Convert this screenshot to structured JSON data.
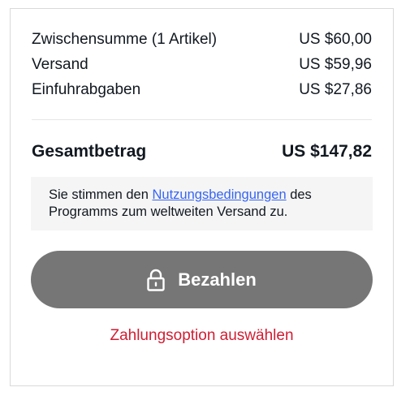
{
  "summary": {
    "lines": [
      {
        "label": "Zwischensumme (1 Artikel)",
        "value": "US $60,00"
      },
      {
        "label": "Versand",
        "value": "US $59,96"
      },
      {
        "label": "Einfuhrabgaben",
        "value": "US $27,86"
      }
    ],
    "total_label": "Gesamtbetrag",
    "total_value": "US $147,82"
  },
  "notice": {
    "text_before": "Sie stimmen den ",
    "link_text": "Nutzungsbedingungen",
    "text_after": " des Programms zum weltweiten Versand zu."
  },
  "pay_button": {
    "label": "Bezahlen",
    "icon": "lock-icon"
  },
  "payment_option_link": "Zahlungsoption auswählen",
  "colors": {
    "button_bg": "#767676",
    "link_blue": "#3665f3",
    "link_red": "#d21c32",
    "notice_bg": "#f5f5f5"
  }
}
